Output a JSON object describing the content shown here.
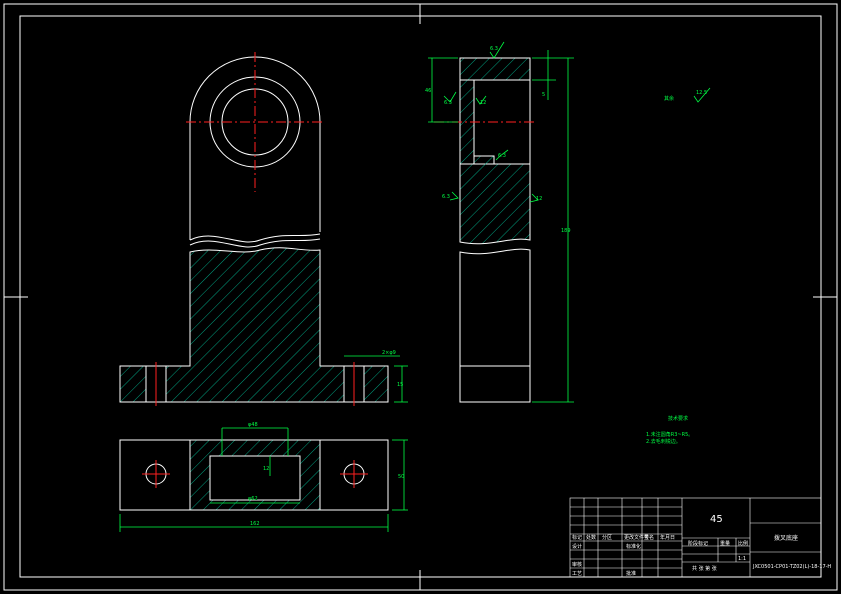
{
  "dimensions": {
    "front_bottom_height": "15",
    "front_hole": "2×φ9",
    "top_inner_top": "φ48",
    "top_inner_bottom": "φ62",
    "top_inner_depth": "12",
    "top_height": "50",
    "top_overall": "162",
    "side_upper": "46",
    "side_small": "5",
    "side_total": "189"
  },
  "surface_finish": {
    "r1": "6.3",
    "r2": "6.3",
    "r3": "12",
    "r4": "6.3",
    "r5": "6.3",
    "r6": "12",
    "other": "其余",
    "other_value": "12.5"
  },
  "tech_req": {
    "title": "技术要求",
    "line1": "1.未注圆角R3~R5。",
    "line2": "2.去毛刺锐边。"
  },
  "title_block": {
    "material": "45",
    "part_name": "拨叉底座",
    "drawing_no": "JXC0501-CP01-TZ02(L)-18-17-H",
    "cells": [
      "标记",
      "处数",
      "分区",
      "更改文件号",
      "签名",
      "年月日",
      "设计",
      "标准化",
      "审核",
      "工艺",
      "批准",
      "阶段标记",
      "重量",
      "比例",
      "共 张 第 张",
      "1:1"
    ]
  }
}
